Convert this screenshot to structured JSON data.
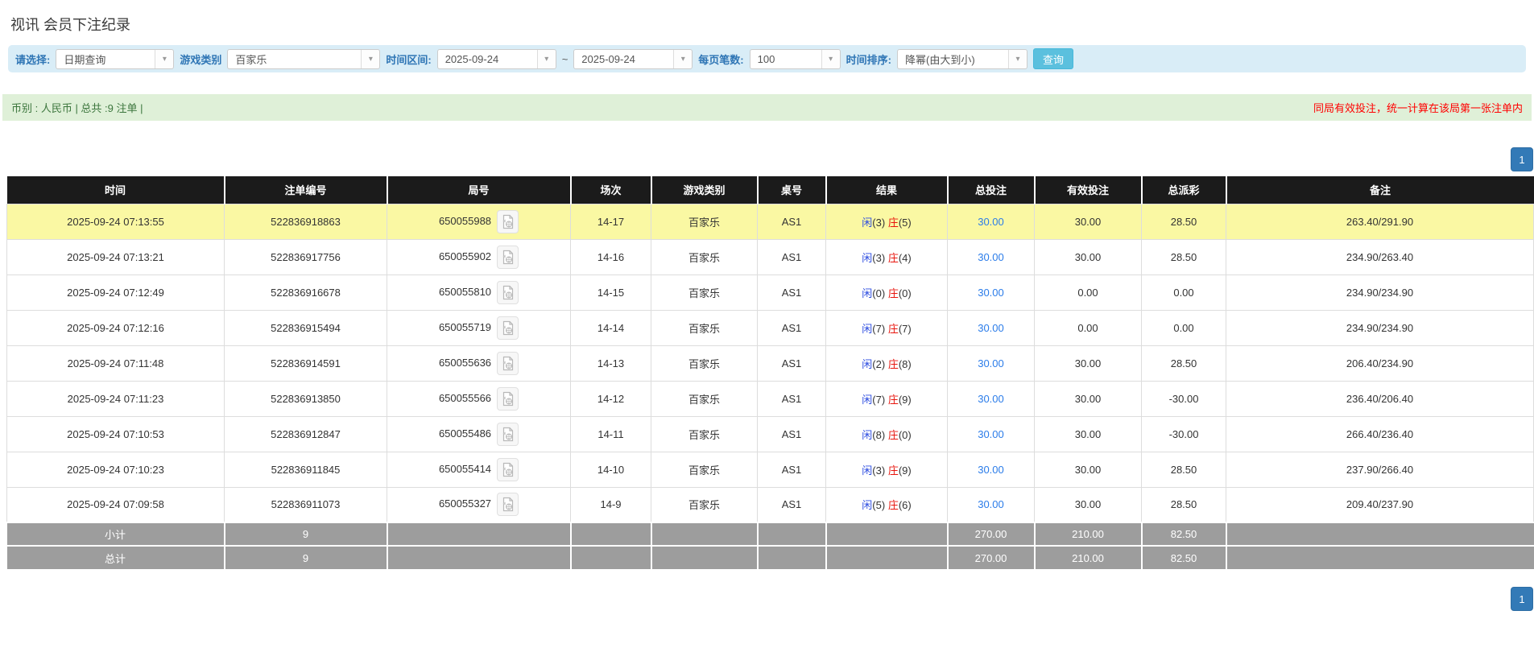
{
  "page": {
    "title": "视讯 会员下注纪录"
  },
  "icons": {
    "caret_down": "▾"
  },
  "colors": {
    "panel_blue": "#d9edf7",
    "panel_green": "#dff0d8",
    "label_blue": "#2e75b5",
    "header_bg": "#1b1b1b",
    "highlight_row": "#faf8a3",
    "summary_row_bg": "#9d9d9d",
    "player_blue": "#2d4de0",
    "banker_red": "#e8150d",
    "link_blue": "#2b7ce9",
    "negative_red": "#ff0000",
    "button_blue": "#5bc0de",
    "pager_blue": "#337ab7",
    "green_text": "#3c763d"
  },
  "filters": {
    "select_label": "请选择:",
    "select_value": "日期查询",
    "game_type_label": "游戏类别",
    "game_type_value": "百家乐",
    "time_range_label": "时间区间:",
    "time_from": "2025-09-24",
    "tilde": "~",
    "time_to": "2025-09-24",
    "page_size_label": "每页笔数:",
    "page_size_value": "100",
    "sort_label": "时间排序:",
    "sort_value": "降幂(由大到小)",
    "search_button": "查询"
  },
  "summary_bar": {
    "left": "币别 : 人民币 | 总共 :9 注单 |",
    "right_notice": "同局有效投注，统一计算在该局第一张注单内"
  },
  "pagination": {
    "page": "1"
  },
  "table": {
    "headers": [
      "时间",
      "注单编号",
      "局号",
      "场次",
      "游戏类别",
      "桌号",
      "结果",
      "总投注",
      "有效投注",
      "总派彩",
      "备注"
    ],
    "rows": [
      {
        "time": "2025-09-24 07:13:55",
        "bet_id": "522836918863",
        "round": "650055988",
        "session": "14-17",
        "game": "百家乐",
        "table_no": "AS1",
        "player": "闲",
        "player_score": "(3)",
        "banker": "庄",
        "banker_score": "(5)",
        "total_bet": "30.00",
        "valid_bet": "30.00",
        "payout": "28.50",
        "remark": "263.40/291.90",
        "highlight": true
      },
      {
        "time": "2025-09-24 07:13:21",
        "bet_id": "522836917756",
        "round": "650055902",
        "session": "14-16",
        "game": "百家乐",
        "table_no": "AS1",
        "player": "闲",
        "player_score": "(3)",
        "banker": "庄",
        "banker_score": "(4)",
        "total_bet": "30.00",
        "valid_bet": "30.00",
        "payout": "28.50",
        "remark": "234.90/263.40",
        "highlight": false
      },
      {
        "time": "2025-09-24 07:12:49",
        "bet_id": "522836916678",
        "round": "650055810",
        "session": "14-15",
        "game": "百家乐",
        "table_no": "AS1",
        "player": "闲",
        "player_score": "(0)",
        "banker": "庄",
        "banker_score": "(0)",
        "total_bet": "30.00",
        "valid_bet": "0.00",
        "payout": "0.00",
        "remark": "234.90/234.90",
        "highlight": false
      },
      {
        "time": "2025-09-24 07:12:16",
        "bet_id": "522836915494",
        "round": "650055719",
        "session": "14-14",
        "game": "百家乐",
        "table_no": "AS1",
        "player": "闲",
        "player_score": "(7)",
        "banker": "庄",
        "banker_score": "(7)",
        "total_bet": "30.00",
        "valid_bet": "0.00",
        "payout": "0.00",
        "remark": "234.90/234.90",
        "highlight": false
      },
      {
        "time": "2025-09-24 07:11:48",
        "bet_id": "522836914591",
        "round": "650055636",
        "session": "14-13",
        "game": "百家乐",
        "table_no": "AS1",
        "player": "闲",
        "player_score": "(2)",
        "banker": "庄",
        "banker_score": "(8)",
        "total_bet": "30.00",
        "valid_bet": "30.00",
        "payout": "28.50",
        "remark": "206.40/234.90",
        "highlight": false
      },
      {
        "time": "2025-09-24 07:11:23",
        "bet_id": "522836913850",
        "round": "650055566",
        "session": "14-12",
        "game": "百家乐",
        "table_no": "AS1",
        "player": "闲",
        "player_score": "(7)",
        "banker": "庄",
        "banker_score": "(9)",
        "total_bet": "30.00",
        "valid_bet": "30.00",
        "payout": "-30.00",
        "remark": "236.40/206.40",
        "highlight": false
      },
      {
        "time": "2025-09-24 07:10:53",
        "bet_id": "522836912847",
        "round": "650055486",
        "session": "14-11",
        "game": "百家乐",
        "table_no": "AS1",
        "player": "闲",
        "player_score": "(8)",
        "banker": "庄",
        "banker_score": "(0)",
        "total_bet": "30.00",
        "valid_bet": "30.00",
        "payout": "-30.00",
        "remark": "266.40/236.40",
        "highlight": false
      },
      {
        "time": "2025-09-24 07:10:23",
        "bet_id": "522836911845",
        "round": "650055414",
        "session": "14-10",
        "game": "百家乐",
        "table_no": "AS1",
        "player": "闲",
        "player_score": "(3)",
        "banker": "庄",
        "banker_score": "(9)",
        "total_bet": "30.00",
        "valid_bet": "30.00",
        "payout": "28.50",
        "remark": "237.90/266.40",
        "highlight": false
      },
      {
        "time": "2025-09-24 07:09:58",
        "bet_id": "522836911073",
        "round": "650055327",
        "session": "14-9",
        "game": "百家乐",
        "table_no": "AS1",
        "player": "闲",
        "player_score": "(5)",
        "banker": "庄",
        "banker_score": "(6)",
        "total_bet": "30.00",
        "valid_bet": "30.00",
        "payout": "28.50",
        "remark": "209.40/237.90",
        "highlight": false
      }
    ],
    "subtotal": {
      "label": "小计",
      "count": "9",
      "total_bet": "270.00",
      "valid_bet": "210.00",
      "payout": "82.50"
    },
    "total": {
      "label": "总计",
      "count": "9",
      "total_bet": "270.00",
      "valid_bet": "210.00",
      "payout": "82.50"
    }
  }
}
